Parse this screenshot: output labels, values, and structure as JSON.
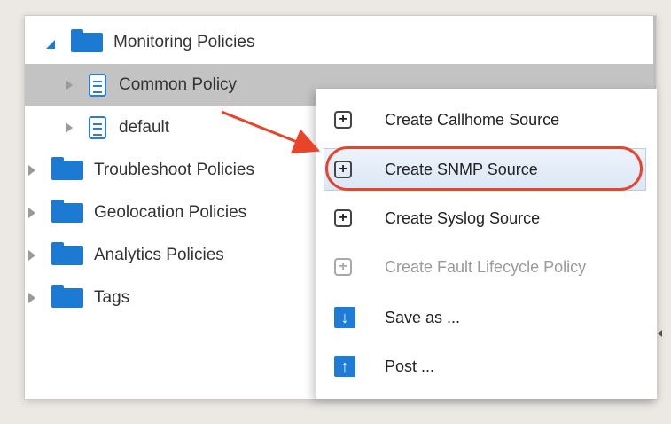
{
  "tree": {
    "items": [
      {
        "label": "Monitoring Policies",
        "kind": "folder",
        "expander": "expanded"
      },
      {
        "label": "Common Policy",
        "kind": "policy",
        "expander": "collapsed",
        "selected": true
      },
      {
        "label": "default",
        "kind": "policy",
        "expander": "collapsed"
      },
      {
        "label": "Troubleshoot Policies",
        "kind": "folder",
        "expander": "collapsed"
      },
      {
        "label": "Geolocation Policies",
        "kind": "folder",
        "expander": "collapsed"
      },
      {
        "label": "Analytics Policies",
        "kind": "folder",
        "expander": "collapsed"
      },
      {
        "label": "Tags",
        "kind": "folder",
        "expander": "collapsed"
      }
    ]
  },
  "context_menu": {
    "items": [
      {
        "label": "Create Callhome Source",
        "icon": "plus-box-icon",
        "enabled": true
      },
      {
        "label": "Create SNMP Source",
        "icon": "plus-box-icon",
        "enabled": true,
        "highlighted": true
      },
      {
        "label": "Create Syslog Source",
        "icon": "plus-box-icon",
        "enabled": true
      },
      {
        "label": "Create Fault Lifecycle Policy",
        "icon": "plus-box-icon",
        "enabled": false
      },
      {
        "label": "Save as ...",
        "icon": "arrow-down-icon",
        "enabled": true
      },
      {
        "label": "Post ...",
        "icon": "arrow-up-icon",
        "enabled": true
      }
    ]
  },
  "colors": {
    "folder_blue": "#1d7ad2",
    "selection_gray": "#c3c3c3",
    "annotation_red": "#e8442a",
    "menu_action_blue": "#1f7bd6"
  }
}
